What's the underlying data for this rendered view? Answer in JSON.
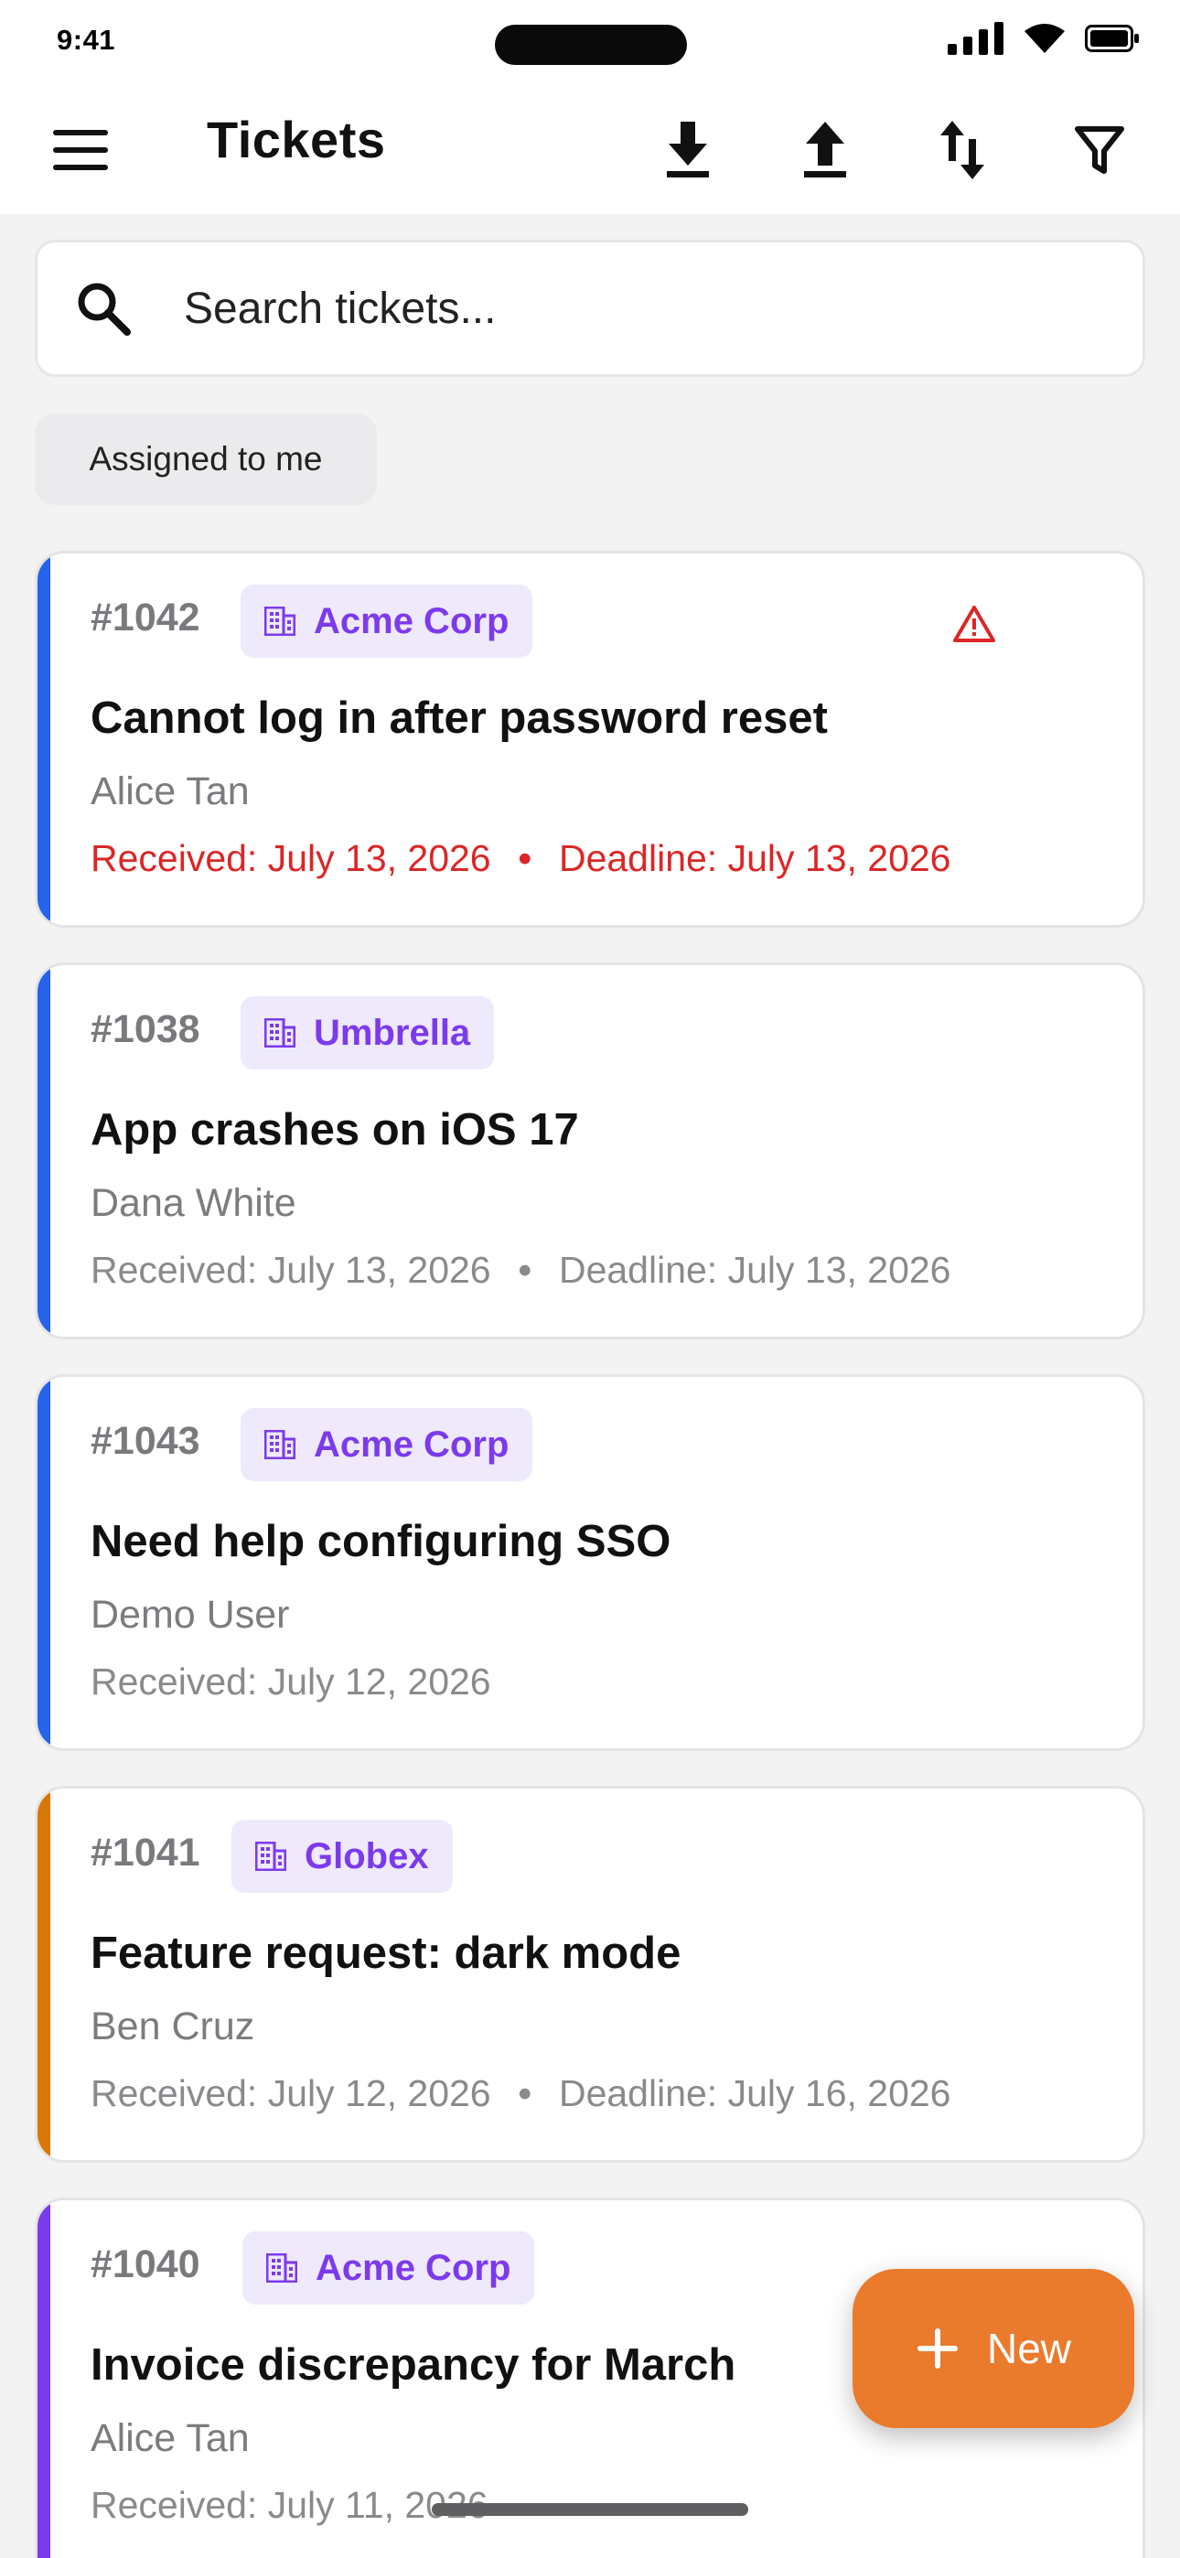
{
  "status_bar": {
    "time": "9:41"
  },
  "header": {
    "title": "Tickets",
    "actions": [
      "download-icon",
      "upload-icon",
      "sort-icon",
      "filter-icon"
    ]
  },
  "search": {
    "placeholder": "Search tickets..."
  },
  "filter_chip": {
    "label": "Assigned to me"
  },
  "tickets": [
    {
      "id": "#1042",
      "org": "Acme Corp",
      "title": "Cannot log in after password reset",
      "requester": "Alice Tan",
      "received": "Received: July 13, 2026",
      "deadline": "Deadline: July 13, 2026",
      "stripe_color": "#2563eb",
      "urgent": true
    },
    {
      "id": "#1038",
      "org": "Umbrella",
      "title": "App crashes on iOS 17",
      "requester": "Dana White",
      "received": "Received: July 13, 2026",
      "deadline": "Deadline: July 13, 2026",
      "stripe_color": "#2563eb",
      "urgent": false
    },
    {
      "id": "#1043",
      "org": "Acme Corp",
      "title": "Need help configuring SSO",
      "requester": "Demo User",
      "received": "Received: July 12, 2026",
      "deadline": "",
      "stripe_color": "#2563eb",
      "urgent": false
    },
    {
      "id": "#1041",
      "org": "Globex",
      "title": "Feature request: dark mode",
      "requester": "Ben Cruz",
      "received": "Received: July 12, 2026",
      "deadline": "Deadline: July 16, 2026",
      "stripe_color": "#d97706",
      "urgent": false
    },
    {
      "id": "#1040",
      "org": "Acme Corp",
      "title": "Invoice discrepancy for March",
      "requester": "Alice Tan",
      "received": "Received: July 11, 2026",
      "deadline": "",
      "stripe_color": "#7c3aed",
      "urgent": false
    }
  ],
  "fab": {
    "label": "New"
  },
  "colors": {
    "accent": "#ea7a2c",
    "org_chip_text": "#7c3aed",
    "urgent": "#dc2626"
  }
}
